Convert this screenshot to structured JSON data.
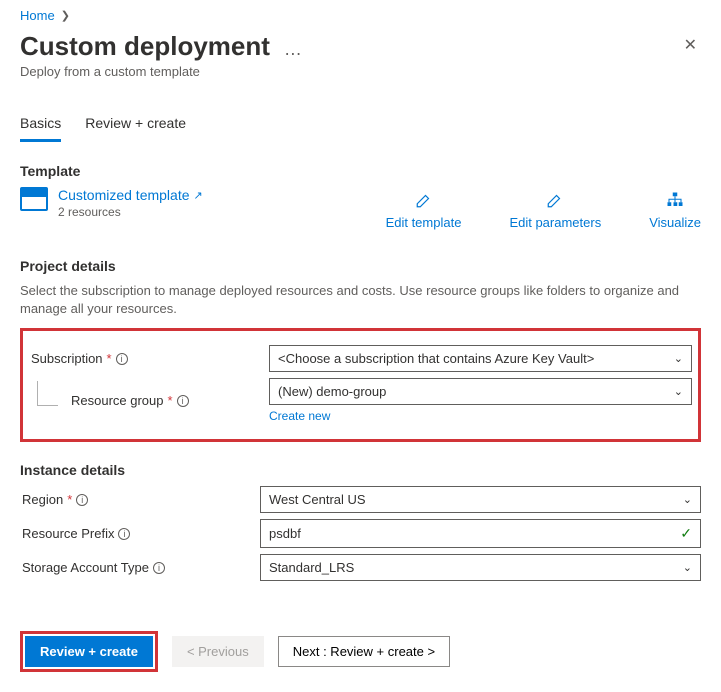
{
  "breadcrumb": {
    "home": "Home"
  },
  "page": {
    "title": "Custom deployment",
    "subtitle": "Deploy from a custom template"
  },
  "tabs": {
    "basics": "Basics",
    "review": "Review + create"
  },
  "template": {
    "heading": "Template",
    "link": "Customized template",
    "resources": "2 resources",
    "actions": {
      "edit_template": "Edit template",
      "edit_parameters": "Edit parameters",
      "visualize": "Visualize"
    }
  },
  "project": {
    "heading": "Project details",
    "desc": "Select the subscription to manage deployed resources and costs. Use resource groups like folders to organize and manage all your resources.",
    "subscription_label": "Subscription",
    "subscription_value": "<Choose a subscription that contains Azure Key Vault>",
    "rg_label": "Resource group",
    "rg_value": "(New) demo-group",
    "create_new": "Create new"
  },
  "instance": {
    "heading": "Instance details",
    "region_label": "Region",
    "region_value": "West Central US",
    "prefix_label": "Resource Prefix",
    "prefix_value": "psdbf",
    "storage_label": "Storage Account Type",
    "storage_value": "Standard_LRS"
  },
  "footer": {
    "review": "Review + create",
    "previous": "< Previous",
    "next": "Next : Review + create >"
  }
}
